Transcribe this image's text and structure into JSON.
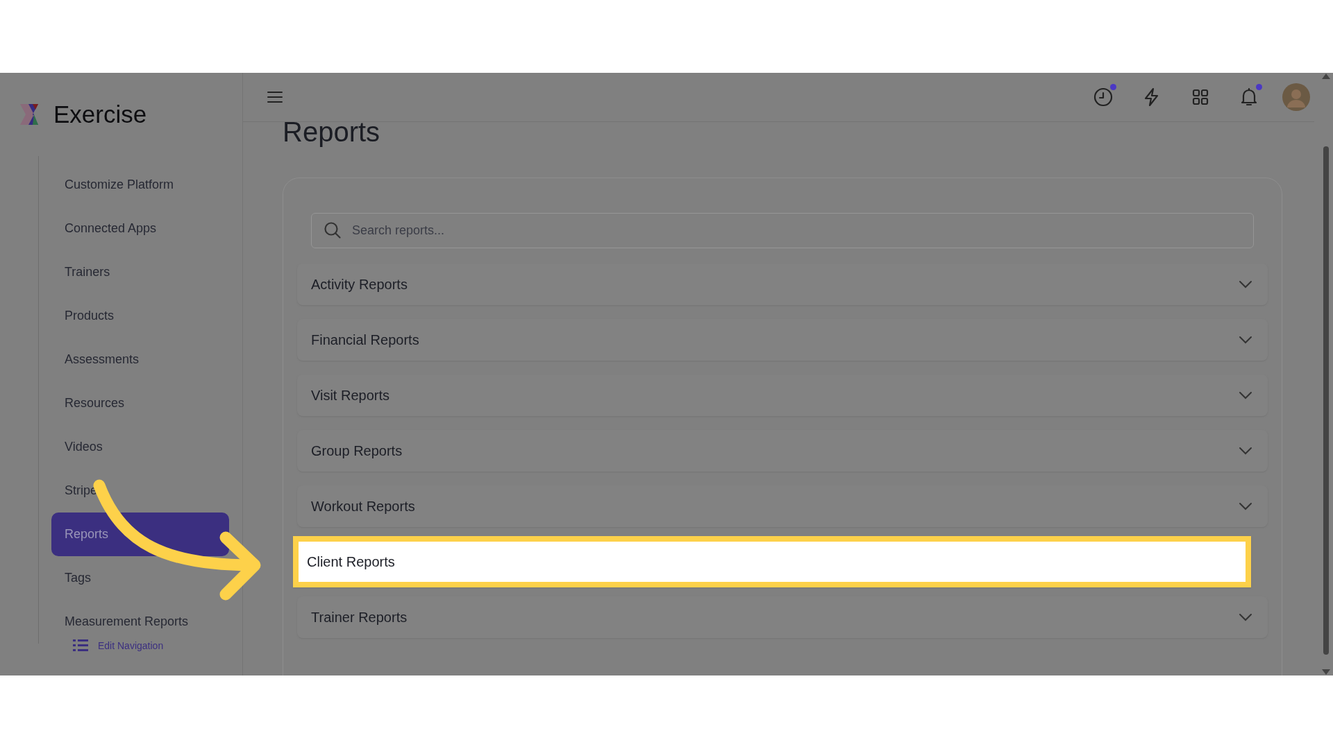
{
  "brand": {
    "name": "Exercise"
  },
  "sidebar": {
    "items": [
      {
        "label": "Customize Platform",
        "selected": false
      },
      {
        "label": "Connected Apps",
        "selected": false
      },
      {
        "label": "Trainers",
        "selected": false
      },
      {
        "label": "Products",
        "selected": false
      },
      {
        "label": "Assessments",
        "selected": false
      },
      {
        "label": "Resources",
        "selected": false
      },
      {
        "label": "Videos",
        "selected": false
      },
      {
        "label": "Stripe",
        "selected": false
      },
      {
        "label": "Reports",
        "selected": true
      },
      {
        "label": "Tags",
        "selected": false
      },
      {
        "label": "Measurement Reports",
        "selected": false
      }
    ],
    "edit_link": "Edit Navigation"
  },
  "header": {
    "icons": [
      {
        "kind": "clock",
        "badge": true
      },
      {
        "kind": "bolt",
        "badge": false
      },
      {
        "kind": "grid",
        "badge": false
      },
      {
        "kind": "bell",
        "badge": true
      },
      {
        "kind": "avatar",
        "badge": false
      }
    ]
  },
  "page_title": "Reports",
  "search": {
    "placeholder": "Search reports..."
  },
  "report_groups": [
    {
      "label": "Activity Reports",
      "highlighted": false
    },
    {
      "label": "Financial Reports",
      "highlighted": false
    },
    {
      "label": "Visit Reports",
      "highlighted": false
    },
    {
      "label": "Group Reports",
      "highlighted": false
    },
    {
      "label": "Workout Reports",
      "highlighted": false
    },
    {
      "label": "Client Reports",
      "highlighted": true
    },
    {
      "label": "Trainer Reports",
      "highlighted": false
    }
  ]
}
